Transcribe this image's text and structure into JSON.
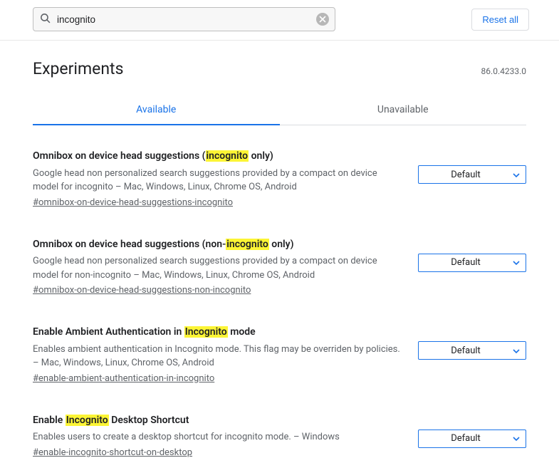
{
  "search": {
    "value": "incognito"
  },
  "reset_label": "Reset all",
  "page_title": "Experiments",
  "version": "86.0.4233.0",
  "tabs": {
    "available": "Available",
    "unavailable": "Unavailable"
  },
  "experiments": [
    {
      "title_pre": "Omnibox on device head suggestions (",
      "title_hl": "incognito",
      "title_post": " only)",
      "desc": "Google head non personalized search suggestions provided by a compact on device model for incognito – Mac, Windows, Linux, Chrome OS, Android",
      "hash": "#omnibox-on-device-head-suggestions-incognito",
      "select": "Default"
    },
    {
      "title_pre": "Omnibox on device head suggestions (non-",
      "title_hl": "incognito",
      "title_post": " only)",
      "desc": "Google head non personalized search suggestions provided by a compact on device model for non-incognito – Mac, Windows, Linux, Chrome OS, Android",
      "hash": "#omnibox-on-device-head-suggestions-non-incognito",
      "select": "Default"
    },
    {
      "title_pre": "Enable Ambient Authentication in ",
      "title_hl": "Incognito",
      "title_post": " mode",
      "desc": "Enables ambient authentication in Incognito mode. This flag may be overriden by policies. – Mac, Windows, Linux, Chrome OS, Android",
      "hash": "#enable-ambient-authentication-in-incognito",
      "select": "Default"
    },
    {
      "title_pre": "Enable ",
      "title_hl": "Incognito",
      "title_post": " Desktop Shortcut",
      "desc": "Enables users to create a desktop shortcut for incognito mode. – Windows",
      "hash": "#enable-incognito-shortcut-on-desktop",
      "select": "Default"
    }
  ]
}
